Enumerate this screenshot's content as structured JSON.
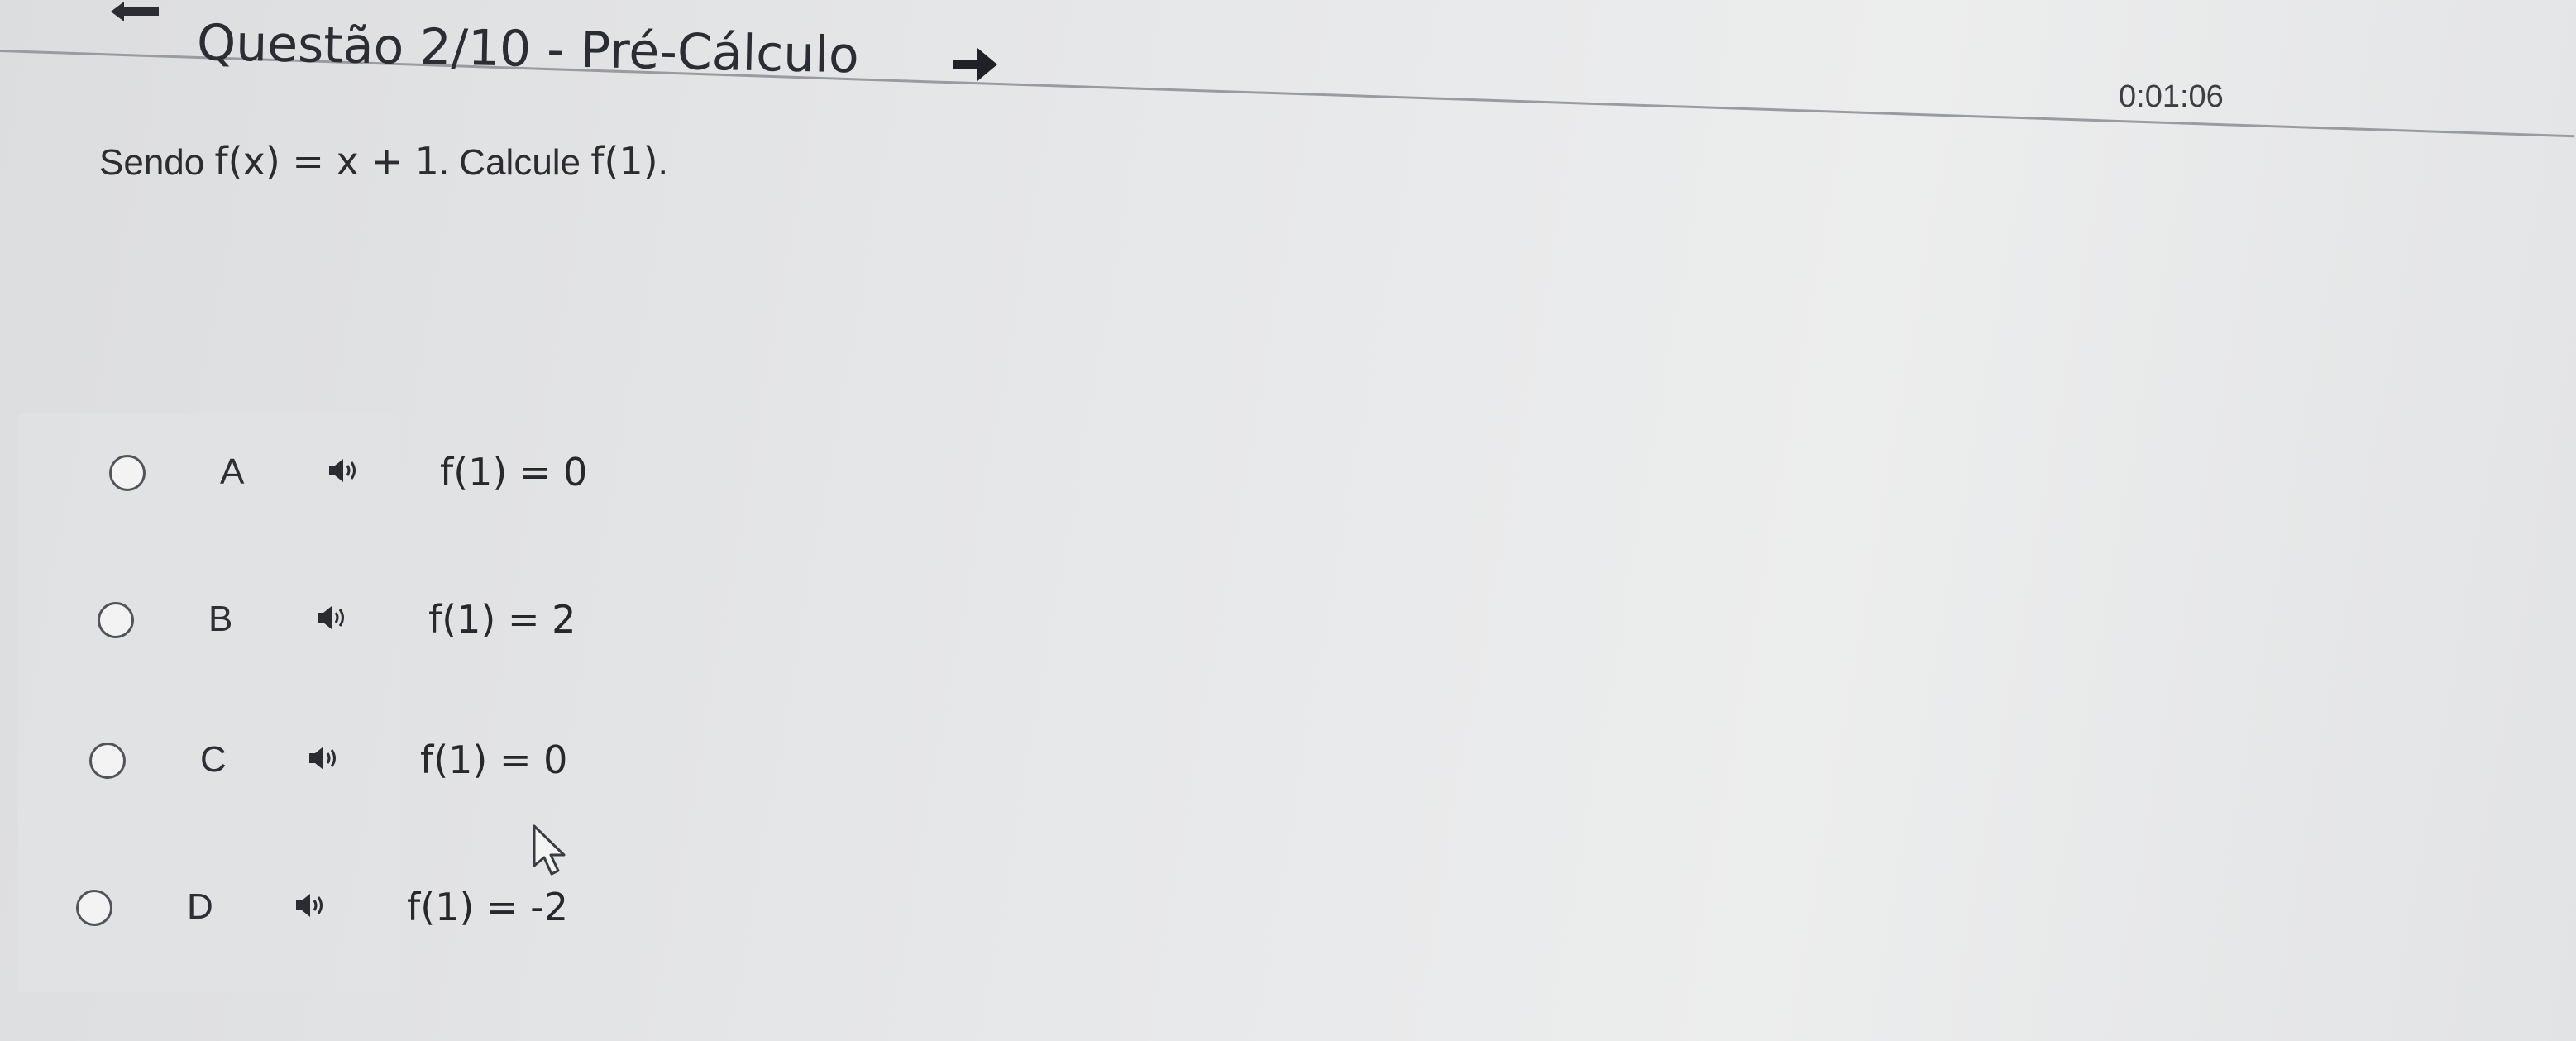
{
  "header": {
    "title": "Questão 2/10 - Pré-Cálculo",
    "back_icon": "arrow-left-icon",
    "next_icon": "arrow-right-icon",
    "timer": "0:01:06"
  },
  "question": {
    "prefix": "Sendo ",
    "function": "f(x) = x + 1",
    "middle": ". Calcule ",
    "target": "f(1)",
    "suffix": "."
  },
  "options": [
    {
      "letter": "A",
      "speaker_icon": "speaker-icon",
      "answer": "f(1) = 0"
    },
    {
      "letter": "B",
      "speaker_icon": "speaker-icon",
      "answer": "f(1) = 2"
    },
    {
      "letter": "C",
      "speaker_icon": "speaker-icon",
      "answer": "f(1) = 0"
    },
    {
      "letter": "D",
      "speaker_icon": "speaker-icon",
      "answer": "f(1) = -2"
    }
  ],
  "colors": {
    "background": "#e6e7e9",
    "text": "#2b2d33",
    "rule": "#9a9ba0",
    "speaker": "#2a2c31"
  }
}
